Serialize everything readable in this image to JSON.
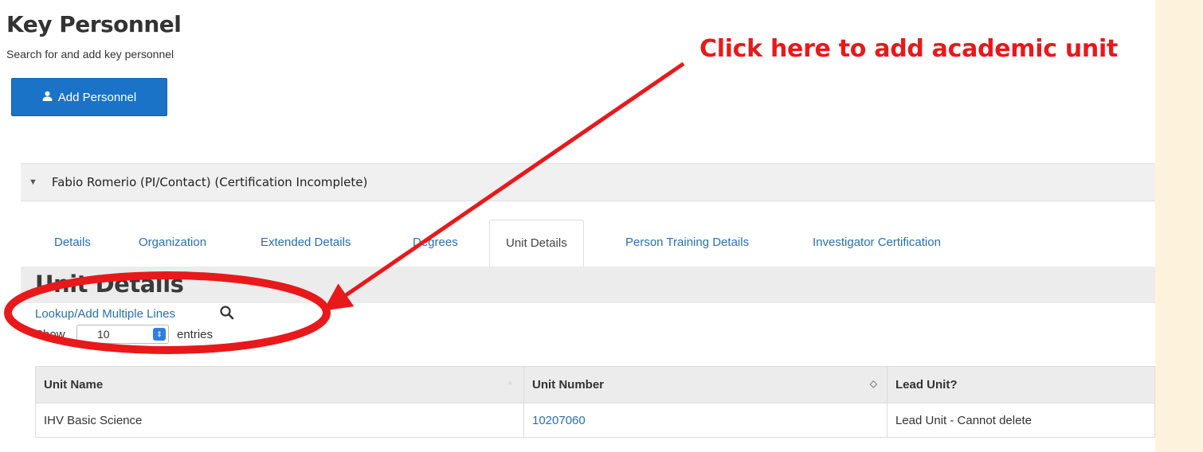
{
  "page": {
    "title": "Key Personnel",
    "subtitle": "Search for and add key personnel",
    "add_button_label": "Add Personnel",
    "add_button_icon": "user-icon"
  },
  "person": {
    "header": "Fabio Romerio (PI/Contact) (Certification Incomplete)",
    "expanded": true
  },
  "tabs": [
    {
      "label": "Details",
      "active": false
    },
    {
      "label": "Organization",
      "active": false
    },
    {
      "label": "Extended Details",
      "active": false
    },
    {
      "label": "Degrees",
      "active": false
    },
    {
      "label": "Unit Details",
      "active": true
    },
    {
      "label": "Person Training Details",
      "active": false
    },
    {
      "label": "Investigator Certification",
      "active": false
    }
  ],
  "unit_details": {
    "title": "Unit Details",
    "lookup_link": "Lookup/Add Multiple Lines",
    "show_label": "Show",
    "entries_value": "10",
    "entries_label": "entries",
    "columns": [
      "Unit Name",
      "Unit Number",
      "Lead Unit?"
    ],
    "rows": [
      {
        "unit_name": "IHV Basic Science",
        "unit_number": "10207060",
        "lead_unit": "Lead Unit - Cannot delete"
      }
    ]
  },
  "annotation": {
    "callout_text": "Click here to add academic unit",
    "color": "#e8191b"
  },
  "colors": {
    "button": "#1a73c7",
    "link": "#2a6fae",
    "backdrop": "#fdf3dc"
  }
}
